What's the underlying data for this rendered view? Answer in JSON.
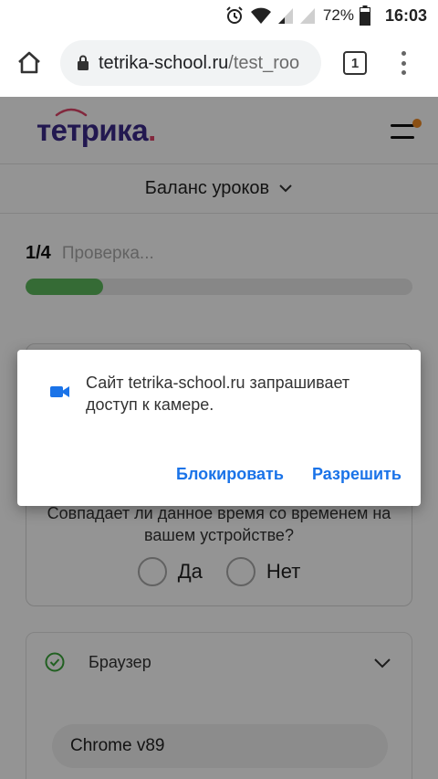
{
  "status_bar": {
    "battery_percent": "72%",
    "time": "16:03",
    "icons": [
      "alarm-icon",
      "wifi-icon",
      "signal-icon",
      "signal-icon",
      "battery-icon"
    ]
  },
  "browser": {
    "url_host": "tetrika-school.ru",
    "url_path": "/test_roo",
    "tab_count": "1",
    "icons": [
      "home-icon",
      "lock-icon",
      "tabs-icon",
      "more-icon"
    ]
  },
  "site": {
    "logo_text": "тетрика",
    "logo_dot": ".",
    "balance_label": "Баланс уроков",
    "step_number": "1/4",
    "step_status": "Проверка...",
    "progress_percent": 20,
    "question": "Совпадает ли данное время со временем на вашем устройстве?",
    "options": [
      "Да",
      "Нет"
    ],
    "browser_section_label": "Браузер",
    "browser_value": "Chrome v89"
  },
  "dialog": {
    "message": "Сайт tetrika-school.ru запрашивает доступ к камере.",
    "block_label": "Блокировать",
    "allow_label": "Разрешить",
    "icon": "camera-icon"
  },
  "colors": {
    "accent": "#1a73e8",
    "logo": "#3b2a8a",
    "logo_dot": "#e0466a",
    "progress": "#5cb85c",
    "notify_dot": "#f08a24"
  }
}
